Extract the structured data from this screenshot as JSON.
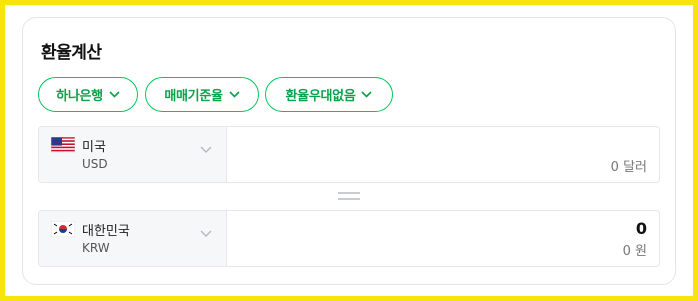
{
  "widget": {
    "title": "환율계산",
    "chips": [
      {
        "label": "하나은행"
      },
      {
        "label": "매매기준율"
      },
      {
        "label": "환율우대없음"
      }
    ],
    "from": {
      "country": "미국",
      "code": "USD",
      "amount": "",
      "unit": "0 달러"
    },
    "to": {
      "country": "대한민국",
      "code": "KRW",
      "amount": "0",
      "unit": "0 원"
    }
  },
  "colors": {
    "accent": "#03c75a",
    "frame": "#f7e40a"
  },
  "icons": [
    "chevron-down-icon",
    "us-flag-icon",
    "kr-flag-icon",
    "equals-icon"
  ]
}
